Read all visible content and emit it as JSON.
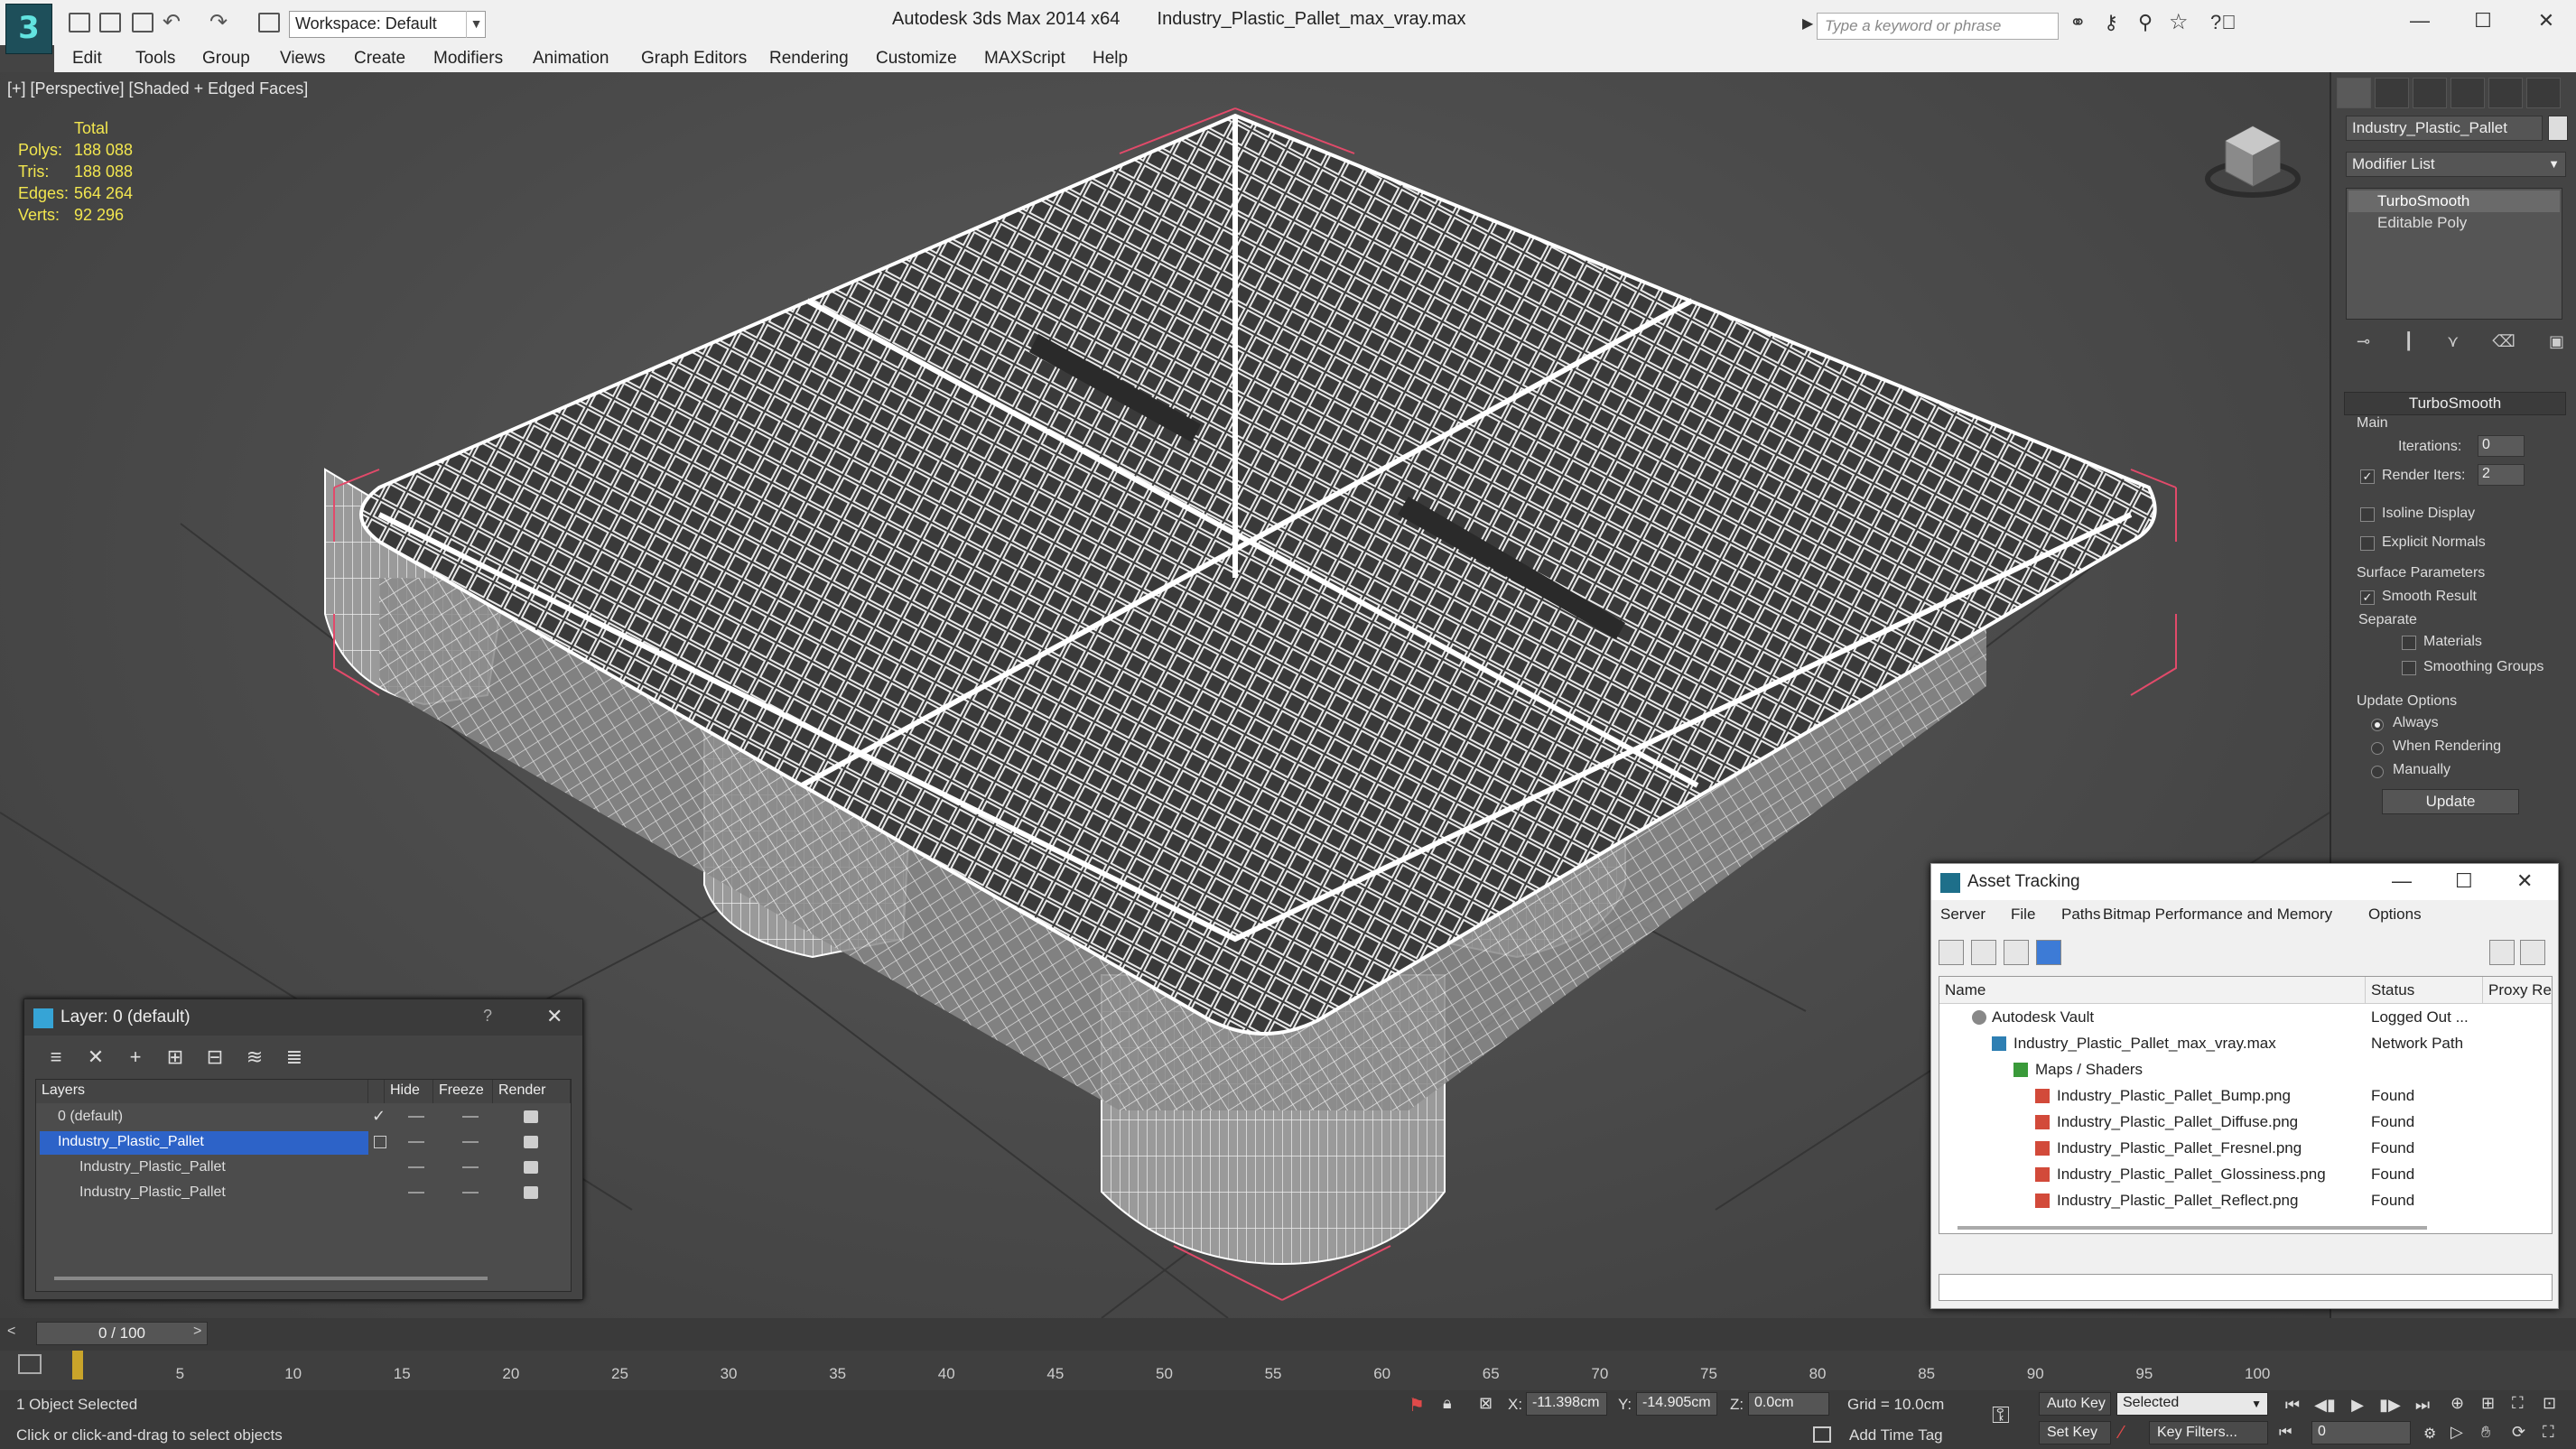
{
  "titlebar": {
    "workspace": "Workspace: Default",
    "app": "Autodesk 3ds Max  2014 x64",
    "file": "Industry_Plastic_Pallet_max_vray.max",
    "search_placeholder": "Type a keyword or phrase"
  },
  "menu": [
    "Edit",
    "Tools",
    "Group",
    "Views",
    "Create",
    "Modifiers",
    "Animation",
    "Graph Editors",
    "Rendering",
    "Customize",
    "MAXScript",
    "Help"
  ],
  "viewport": {
    "label": "[+] [Perspective] [Shaded + Edged Faces]",
    "stats": {
      "header": "Total",
      "rows": [
        {
          "k": "Polys:",
          "v": "188 088"
        },
        {
          "k": "Tris:",
          "v": "188 088"
        },
        {
          "k": "Edges:",
          "v": "564 264"
        },
        {
          "k": "Verts:",
          "v": "92 296"
        }
      ]
    }
  },
  "command_panel": {
    "object_name": "Industry_Plastic_Pallet",
    "modifier_list": "Modifier List",
    "stack": [
      "TurboSmooth",
      "Editable Poly"
    ],
    "rollout_title": "TurboSmooth",
    "main_label": "Main",
    "iterations_label": "Iterations:",
    "iterations": "0",
    "render_iters_label": "Render Iters:",
    "render_iters": "2",
    "isoline": "Isoline Display",
    "explicit_normals": "Explicit Normals",
    "surface_params": "Surface Parameters",
    "smooth_result": "Smooth Result",
    "separate": "Separate",
    "materials": "Materials",
    "smoothing_groups": "Smoothing Groups",
    "update_options": "Update Options",
    "always": "Always",
    "when_rendering": "When Rendering",
    "manually": "Manually",
    "update_btn": "Update"
  },
  "layer_dialog": {
    "title": "Layer: 0 (default)",
    "help": "?",
    "columns": [
      "Layers",
      "Hide",
      "Freeze",
      "Render"
    ],
    "rows": [
      {
        "name": "0 (default)",
        "indent": 0
      },
      {
        "name": "Industry_Plastic_Pallet",
        "indent": 0
      },
      {
        "name": "Industry_Plastic_Pallet",
        "indent": 1
      },
      {
        "name": "Industry_Plastic_Pallet",
        "indent": 1
      }
    ]
  },
  "asset_tracking": {
    "title": "Asset Tracking",
    "menu": [
      "Server",
      "File",
      "Paths",
      "Bitmap Performance and Memory",
      "Options"
    ],
    "columns": [
      "Name",
      "Status",
      "Proxy Re"
    ],
    "rows": [
      {
        "name": "Autodesk Vault",
        "status": "Logged Out ..."
      },
      {
        "name": "Industry_Plastic_Pallet_max_vray.max",
        "status": "Network Path"
      },
      {
        "name": "Maps / Shaders",
        "status": ""
      },
      {
        "name": "Industry_Plastic_Pallet_Bump.png",
        "status": "Found"
      },
      {
        "name": "Industry_Plastic_Pallet_Diffuse.png",
        "status": "Found"
      },
      {
        "name": "Industry_Plastic_Pallet_Fresnel.png",
        "status": "Found"
      },
      {
        "name": "Industry_Plastic_Pallet_Glossiness.png",
        "status": "Found"
      },
      {
        "name": "Industry_Plastic_Pallet_Reflect.png",
        "status": "Found"
      }
    ]
  },
  "timeline": {
    "frame": "0 / 100",
    "ticks": [
      "5",
      "10",
      "15",
      "20",
      "25",
      "30",
      "35",
      "40",
      "45",
      "50",
      "55",
      "60",
      "65",
      "70",
      "75",
      "80",
      "85",
      "90",
      "95",
      "100"
    ]
  },
  "status": {
    "selected": "1 Object Selected",
    "prompt": "Click or click-and-drag to select objects",
    "x_label": "X:",
    "x": "-11.398cm",
    "y_label": "Y:",
    "y": "-14.905cm",
    "z_label": "Z:",
    "z": "0.0cm",
    "grid": "Grid = 10.0cm",
    "add_time_tag": "Add Time Tag",
    "auto_key": "Auto Key",
    "set_key": "Set Key",
    "key_mode": "Selected",
    "key_filters": "Key Filters...",
    "frame_field": "0"
  },
  "colors": {
    "stats_text": "#f2e64f",
    "selection": "#2d63c8",
    "bbox_bracket": "#e24a6a"
  }
}
